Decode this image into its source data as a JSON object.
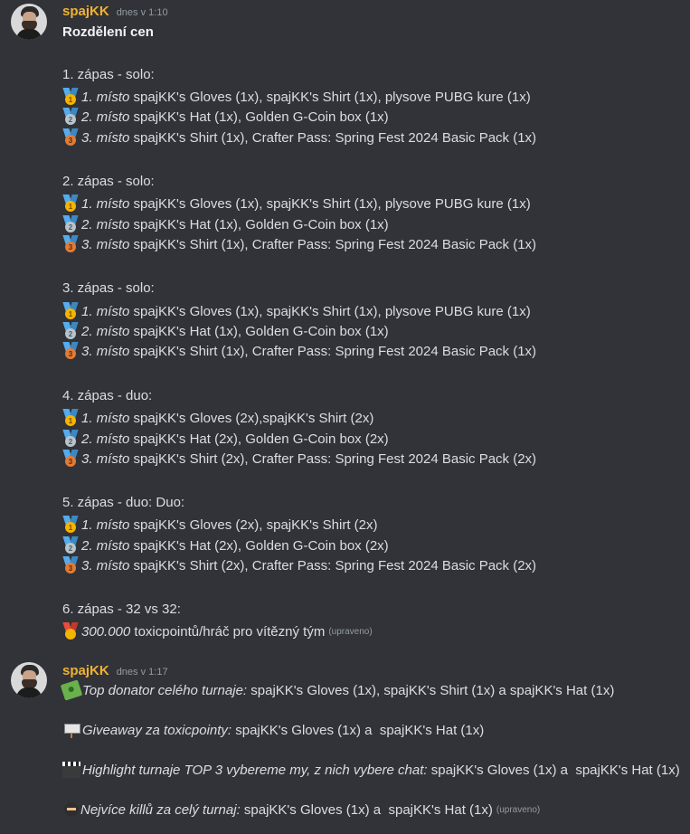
{
  "messages": [
    {
      "username": "spajKK",
      "timestamp": "dnes v 1:10",
      "title": "Rozdělení cen",
      "matches": [
        {
          "heading": "1. zápas - solo:",
          "rows": [
            {
              "place": "1. místo",
              "prize": " spajKK's Gloves (1x), spajKK's Shirt (1x), plysove PUBG kure (1x)"
            },
            {
              "place": "2. místo",
              "prize": " spajKK's Hat (1x), Golden G-Coin box (1x)"
            },
            {
              "place": "3. místo",
              "prize": " spajKK's Shirt (1x), Crafter Pass: Spring Fest 2024 Basic Pack (1x)"
            }
          ]
        },
        {
          "heading": "2. zápas - solo:",
          "rows": [
            {
              "place": "1. místo",
              "prize": " spajKK's Gloves (1x), spajKK's Shirt (1x), plysove PUBG kure (1x)"
            },
            {
              "place": "2. místo",
              "prize": " spajKK's Hat (1x), Golden G-Coin box (1x)"
            },
            {
              "place": "3. místo",
              "prize": " spajKK's Shirt (1x), Crafter Pass: Spring Fest 2024 Basic Pack (1x)"
            }
          ]
        },
        {
          "heading": "3. zápas - solo:",
          "rows": [
            {
              "place": "1. místo",
              "prize": " spajKK's Gloves (1x), spajKK's Shirt (1x), plysove PUBG kure (1x)"
            },
            {
              "place": "2. místo",
              "prize": " spajKK's Hat (1x), Golden G-Coin box (1x)"
            },
            {
              "place": "3. místo",
              "prize": " spajKK's Shirt (1x), Crafter Pass: Spring Fest 2024 Basic Pack (1x)"
            }
          ]
        },
        {
          "heading": "4. zápas - duo:",
          "rows": [
            {
              "place": "1. místo",
              "prize": " spajKK's Gloves (2x),spajKK's Shirt (2x)"
            },
            {
              "place": "2. místo",
              "prize": " spajKK's Hat (2x), Golden G-Coin box (2x)"
            },
            {
              "place": "3. místo",
              "prize": " spajKK's Shirt (2x), Crafter Pass: Spring Fest 2024 Basic Pack (2x)"
            }
          ]
        },
        {
          "heading": "5. zápas - duo: Duo:",
          "rows": [
            {
              "place": "1. místo",
              "prize": " spajKK's Gloves (2x), spajKK's Shirt (2x)"
            },
            {
              "place": "2. místo",
              "prize": " spajKK's Hat (2x), Golden G-Coin box (2x)"
            },
            {
              "place": "3. místo",
              "prize": " spajKK's Shirt (2x), Crafter Pass: Spring Fest 2024 Basic Pack (2x)"
            }
          ]
        }
      ],
      "final_heading": "6. zápas - 32 vs 32:",
      "final_amount": "300.000",
      "final_text": " toxicpointů/hráč pro vítězný tým",
      "edited": "(upraveno)",
      "icons": {
        "gold": "1st-place-medal-icon",
        "silver": "2nd-place-medal-icon",
        "bronze": "3rd-place-medal-icon",
        "military": "military-medal-icon"
      },
      "medal_numbers": [
        "1",
        "2",
        "3"
      ]
    },
    {
      "username": "spajKK",
      "timestamp": "dnes v 1:17",
      "lines": [
        {
          "label": "Top donator celého turnaje:",
          "text": " spajKK's Gloves (1x), spajKK's Shirt (1x) a spajKK's Hat (1x)",
          "icon": "money-with-wings-icon"
        },
        {
          "label": "Giveaway za toxicpointy:",
          "text": " spajKK's Gloves (1x) a  spajKK's Hat (1x)",
          "icon": "placard-icon"
        },
        {
          "label": "Highlight turnaje TOP 3 vybereme my, z nich vybere chat:",
          "text": " spajKK's Gloves (1x) a  spajKK's Hat (1x)",
          "icon": "clapper-board-icon"
        },
        {
          "label": "Nejvíce killů za celý turnaj:",
          "text": " spajKK's Gloves (1x) a  spajKK's Hat (1x)",
          "icon": "ninja-icon"
        }
      ],
      "edited": "(upraveno)"
    }
  ],
  "colors": {
    "background": "#313338",
    "text": "#dbdee1",
    "username": "#f0b232",
    "muted": "#949ba4"
  }
}
